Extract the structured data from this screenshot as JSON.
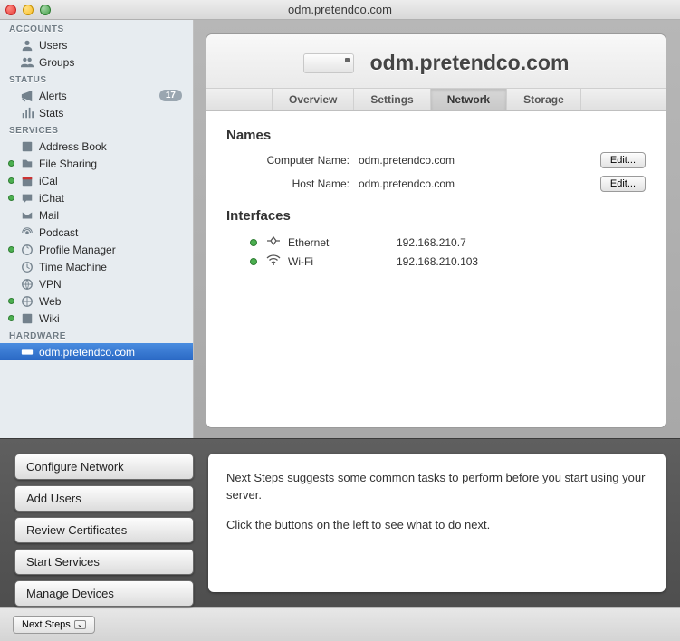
{
  "window": {
    "title": "odm.pretendco.com"
  },
  "sidebar": {
    "sections": [
      {
        "header": "ACCOUNTS",
        "items": [
          {
            "label": "Users",
            "icon": "user-icon"
          },
          {
            "label": "Groups",
            "icon": "group-icon"
          }
        ]
      },
      {
        "header": "STATUS",
        "items": [
          {
            "label": "Alerts",
            "icon": "alert-icon",
            "badge": "17"
          },
          {
            "label": "Stats",
            "icon": "stats-icon"
          }
        ]
      },
      {
        "header": "SERVICES",
        "items": [
          {
            "label": "Address Book",
            "icon": "addressbook-icon",
            "running": false
          },
          {
            "label": "File Sharing",
            "icon": "fileshare-icon",
            "running": true
          },
          {
            "label": "iCal",
            "icon": "ical-icon",
            "running": true
          },
          {
            "label": "iChat",
            "icon": "ichat-icon",
            "running": true
          },
          {
            "label": "Mail",
            "icon": "mail-icon",
            "running": false
          },
          {
            "label": "Podcast",
            "icon": "podcast-icon",
            "running": false
          },
          {
            "label": "Profile Manager",
            "icon": "profile-icon",
            "running": true
          },
          {
            "label": "Time Machine",
            "icon": "timemachine-icon",
            "running": false
          },
          {
            "label": "VPN",
            "icon": "vpn-icon",
            "running": false
          },
          {
            "label": "Web",
            "icon": "web-icon",
            "running": true
          },
          {
            "label": "Wiki",
            "icon": "wiki-icon",
            "running": true
          }
        ]
      },
      {
        "header": "HARDWARE",
        "items": [
          {
            "label": "odm.pretendco.com",
            "icon": "server-icon",
            "selected": true
          }
        ]
      }
    ]
  },
  "header": {
    "hostname": "odm.pretendco.com"
  },
  "tabs": [
    {
      "label": "Overview"
    },
    {
      "label": "Settings"
    },
    {
      "label": "Network",
      "active": true
    },
    {
      "label": "Storage"
    }
  ],
  "names": {
    "section_title": "Names",
    "computer_name_label": "Computer Name:",
    "computer_name_value": "odm.pretendco.com",
    "host_name_label": "Host Name:",
    "host_name_value": "odm.pretendco.com",
    "edit_label": "Edit..."
  },
  "interfaces": {
    "section_title": "Interfaces",
    "list": [
      {
        "name": "Ethernet",
        "ip": "192.168.210.7",
        "up": true,
        "icon": "ethernet-icon"
      },
      {
        "name": "Wi-Fi",
        "ip": "192.168.210.103",
        "up": true,
        "icon": "wifi-icon"
      }
    ]
  },
  "next_steps": {
    "buttons": [
      "Configure Network",
      "Add Users",
      "Review Certificates",
      "Start Services",
      "Manage Devices"
    ],
    "text1": "Next Steps suggests some common tasks to perform before you start using your server.",
    "text2": "Click the buttons on the left to see what to do next.",
    "toggle_label": "Next Steps"
  }
}
